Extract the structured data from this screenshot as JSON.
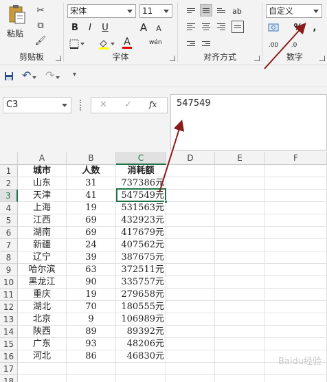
{
  "ribbon": {
    "clipboard": {
      "paste_label": "粘贴",
      "group_label": "剪贴板"
    },
    "font": {
      "font_name": "宋体",
      "font_size": "11",
      "bold": "B",
      "italic": "I",
      "underline": "U",
      "grow": "A",
      "shrink": "A",
      "font_color_glyph": "A",
      "phonetic": "wén",
      "group_label": "字体"
    },
    "alignment": {
      "wrap_glyph": "ab",
      "group_label": "对齐方式"
    },
    "number": {
      "format": "自定义",
      "percent": "%",
      "comma": ",",
      "dec_more": ".00",
      "dec_less": ".0",
      "group_label": "数字"
    }
  },
  "formula_bar": {
    "name_box": "C3",
    "cancel": "✕",
    "enter": "✓",
    "fx": "fx",
    "formula": "547549"
  },
  "columns": [
    "A",
    "B",
    "C",
    "D",
    "E",
    "F"
  ],
  "rows": [
    {
      "n": "1",
      "a": "城市",
      "b": "人数",
      "c": "消耗额"
    },
    {
      "n": "2",
      "a": "山东",
      "b": "31",
      "c": "737386元"
    },
    {
      "n": "3",
      "a": "天津",
      "b": "41",
      "c": "547549元"
    },
    {
      "n": "4",
      "a": "上海",
      "b": "19",
      "c": "531563元"
    },
    {
      "n": "5",
      "a": "江西",
      "b": "69",
      "c": "432923元"
    },
    {
      "n": "6",
      "a": "湖南",
      "b": "69",
      "c": "417679元"
    },
    {
      "n": "7",
      "a": "新疆",
      "b": "24",
      "c": "407562元"
    },
    {
      "n": "8",
      "a": "辽宁",
      "b": "39",
      "c": "387675元"
    },
    {
      "n": "9",
      "a": "哈尔滨",
      "b": "63",
      "c": "372511元"
    },
    {
      "n": "10",
      "a": "黑龙江",
      "b": "90",
      "c": "335757元"
    },
    {
      "n": "11",
      "a": "重庆",
      "b": "19",
      "c": "279658元"
    },
    {
      "n": "12",
      "a": "湖北",
      "b": "70",
      "c": "180555元"
    },
    {
      "n": "13",
      "a": "北京",
      "b": "9",
      "c": "106989元"
    },
    {
      "n": "14",
      "a": "陕西",
      "b": "89",
      "c": "89392元"
    },
    {
      "n": "15",
      "a": "广东",
      "b": "93",
      "c": "48206元"
    },
    {
      "n": "16",
      "a": "河北",
      "b": "86",
      "c": "46830元"
    },
    {
      "n": "17",
      "a": "",
      "b": "",
      "c": ""
    },
    {
      "n": "18",
      "a": "",
      "b": "",
      "c": ""
    }
  ],
  "watermark": "Baidu经验",
  "colors": {
    "accent": "#217346",
    "annotation": "#8b1a1a"
  }
}
